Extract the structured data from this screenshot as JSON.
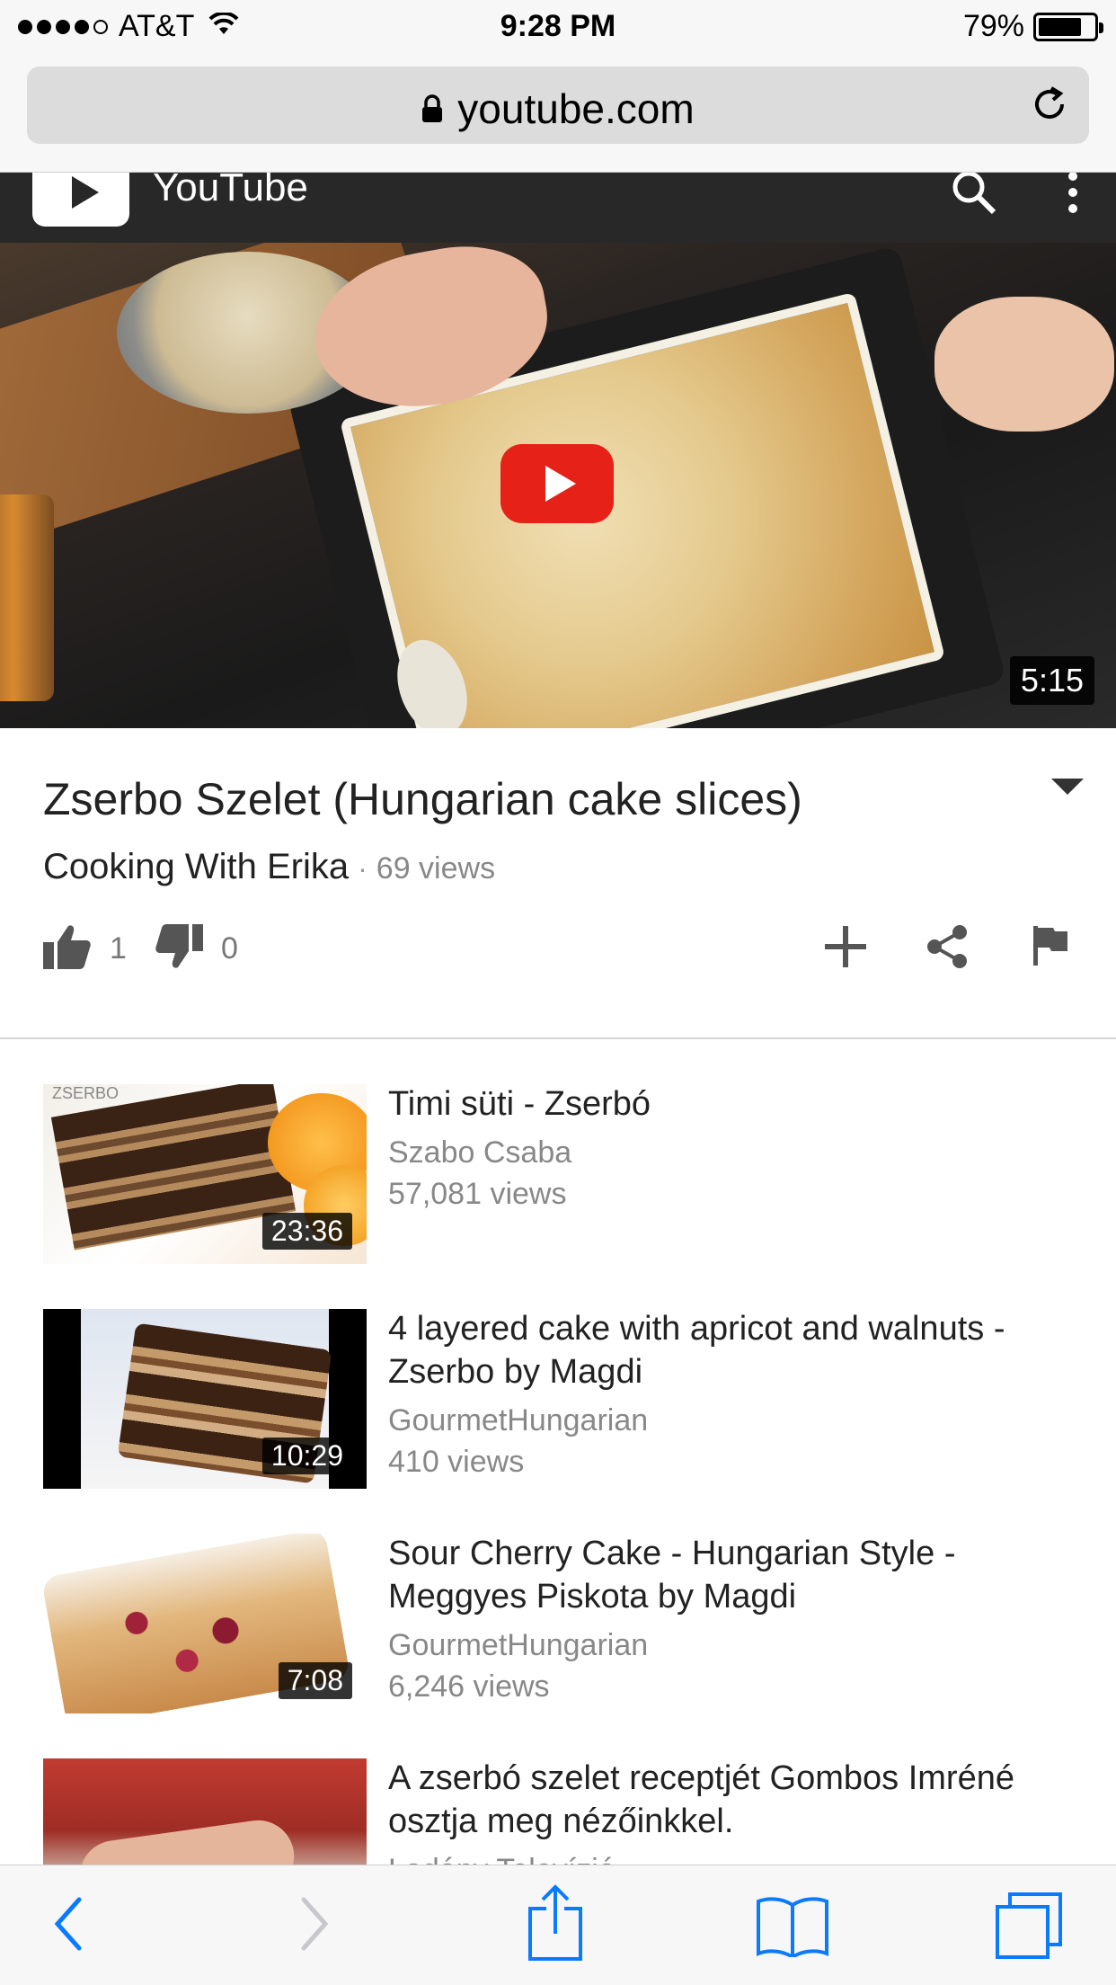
{
  "status_bar": {
    "carrier": "AT&T",
    "time": "9:28 PM",
    "battery_percent": "79%",
    "battery_level": 0.79,
    "signal_bars_filled": 4,
    "signal_bars_total": 5
  },
  "browser": {
    "url": "youtube.com"
  },
  "youtube_header": {
    "title": "YouTube"
  },
  "player": {
    "duration": "5:15"
  },
  "video": {
    "title": "Zserbo Szelet (Hungarian cake slices)",
    "channel": "Cooking With Erika",
    "separator": "·",
    "views": "69 views",
    "likes": "1",
    "dislikes": "0"
  },
  "related": [
    {
      "title": "Timi süti - Zserbó",
      "channel": "Szabo Csaba",
      "views": "57,081 views",
      "duration": "23:36",
      "thumb_label": "ZSERBO"
    },
    {
      "title": "4 layered cake with apricot and walnuts - Zserbo by Magdi",
      "channel": "GourmetHungarian",
      "views": "410 views",
      "duration": "10:29"
    },
    {
      "title": "Sour Cherry Cake - Hungarian Style - Meggyes Piskota by Magdi",
      "channel": "GourmetHungarian",
      "views": "6,246 views",
      "duration": "7:08"
    },
    {
      "title": "A zserbó szelet receptjét Gombos Imréné osztja meg nézőinkkel.",
      "channel": "Ladány Televízió",
      "views": "",
      "duration": ""
    }
  ],
  "colors": {
    "youtube_red": "#e62117",
    "header_dark": "#282828",
    "ios_blue": "#0a7aff",
    "ios_gray": "#c7c7cc"
  }
}
